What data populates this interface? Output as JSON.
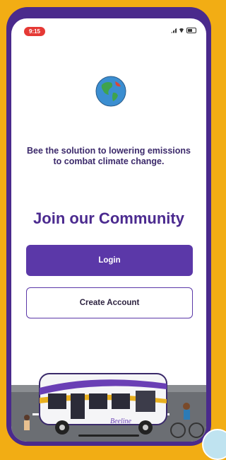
{
  "status_bar": {
    "time": "9:15"
  },
  "tagline": "Bee the solution to lowering emissions to combat climate change.",
  "title": "Join our Community",
  "buttons": {
    "login": "Login",
    "create_account": "Create Account"
  },
  "illustration": {
    "bus_brand": "Beeline"
  },
  "colors": {
    "background": "#F2AD14",
    "frame": "#4A2A8C",
    "primary": "#5B38A8",
    "title": "#4B2A8F"
  },
  "icons": [
    "globe-icon",
    "signal-icon",
    "wifi-icon",
    "battery-icon"
  ]
}
